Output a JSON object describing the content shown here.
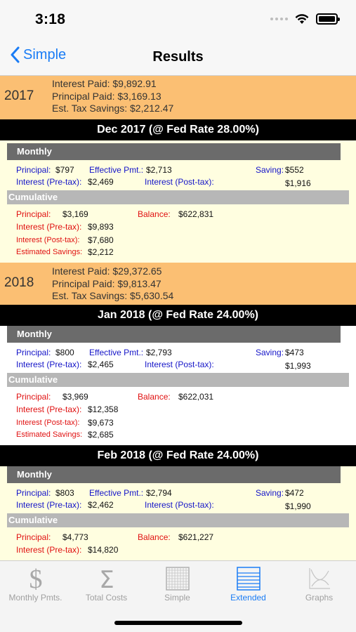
{
  "status": {
    "time": "3:18"
  },
  "nav": {
    "back_label": "Simple",
    "title": "Results"
  },
  "years": {
    "y2017": {
      "year": "2017",
      "interest": "Interest Paid: $9,892.91",
      "principal": "Principal Paid: $3,169.13",
      "savings": "Est. Tax Savings: $2,212.47"
    },
    "y2018": {
      "year": "2018",
      "interest": "Interest Paid: $29,372.65",
      "principal": "Principal Paid: $9,813.47",
      "savings": "Est. Tax Savings: $5,630.54"
    }
  },
  "labels": {
    "monthly": "Monthly",
    "cumulative": "Cumulative",
    "principal": "Principal:",
    "effective_pmt": "Effective Pmt.:",
    "saving": "Saving:",
    "interest_pre": "Interest (Pre-tax):",
    "interest_post": "Interest (Post-tax):",
    "balance": "Balance:",
    "estimated_savings": "Estimated Savings:"
  },
  "months": {
    "dec2017": {
      "title": "Dec 2017 (@ Fed Rate 28.00%)",
      "monthly": {
        "principal": "$797",
        "effective_pmt": "$2,713",
        "saving": "$552",
        "interest_pre": "$2,469",
        "interest_post": "$1,916"
      },
      "cumulative": {
        "principal": "$3,169",
        "balance": "$622,831",
        "interest_pre": "$9,893",
        "interest_post": "$7,680",
        "estimated_savings": "$2,212"
      }
    },
    "jan2018": {
      "title": "Jan 2018 (@ Fed Rate 24.00%)",
      "monthly": {
        "principal": "$800",
        "effective_pmt": "$2,793",
        "saving": "$473",
        "interest_pre": "$2,465",
        "interest_post": "$1,993"
      },
      "cumulative": {
        "principal": "$3,969",
        "balance": "$622,031",
        "interest_pre": "$12,358",
        "interest_post": "$9,673",
        "estimated_savings": "$2,685"
      }
    },
    "feb2018": {
      "title": "Feb 2018 (@ Fed Rate 24.00%)",
      "monthly": {
        "principal": "$803",
        "effective_pmt": "$2,794",
        "saving": "$472",
        "interest_pre": "$2,462",
        "interest_post": "$1,990"
      },
      "cumulative": {
        "principal": "$4,773",
        "balance": "$621,227",
        "interest_pre": "$14,820"
      }
    }
  },
  "tabs": [
    {
      "label": "Monthly Pmts.",
      "icon": "dollar-icon"
    },
    {
      "label": "Total Costs",
      "icon": "sigma-icon"
    },
    {
      "label": "Simple",
      "icon": "grid-icon"
    },
    {
      "label": "Extended",
      "icon": "list-icon",
      "active": true
    },
    {
      "label": "Graphs",
      "icon": "graph-icon"
    }
  ],
  "colors": {
    "accent": "#1a7cf5",
    "year_band": "#fbbf73",
    "row_yellow": "#fffee0",
    "label_blue": "#1414c8",
    "label_red": "#e01010"
  }
}
